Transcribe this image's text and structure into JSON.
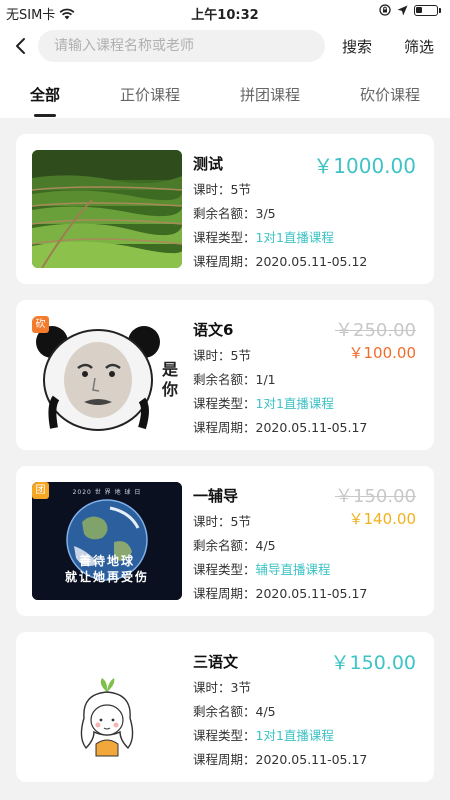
{
  "status_bar": {
    "carrier": "无SIM卡",
    "time": "上午10:32",
    "battery_level": 0.3
  },
  "header": {
    "search_placeholder": "请输入课程名称或老师",
    "search_label": "搜索",
    "filter_label": "筛选"
  },
  "tabs": [
    {
      "label": "全部",
      "active": true
    },
    {
      "label": "正价课程",
      "active": false
    },
    {
      "label": "拼团课程",
      "active": false
    },
    {
      "label": "砍价课程",
      "active": false
    }
  ],
  "labels": {
    "hours": "课时：",
    "remaining": "剩余名额：",
    "type": "课程类型：",
    "period": "课程周期："
  },
  "courses": [
    {
      "title": "测试",
      "price": "￥1000.00",
      "hours": "5节",
      "remaining": "3/5",
      "type": "1对1直播课程",
      "period": "2020.05.11-05.12"
    },
    {
      "title": "语文6",
      "badge": "砍",
      "badge_color": "#f47a2c",
      "original_price": "￥250.00",
      "price": "￥100.00",
      "price_color": "#f36b2a",
      "hours": "5节",
      "remaining": "1/1",
      "type": "1对1直播课程",
      "period": "2020.05.11-05.17",
      "thumb_text": "是你"
    },
    {
      "title": "一辅导",
      "badge": "团",
      "badge_color": "#f5a623",
      "original_price": "￥150.00",
      "price": "￥140.00",
      "price_color": "#f1b11b",
      "hours": "5节",
      "remaining": "4/5",
      "type": "辅导直播课程",
      "period": "2020.05.11-05.17",
      "thumb_top": "2020 世 界 地 球 日",
      "thumb_line1": "善待地球",
      "thumb_line2": "就让她再受伤"
    },
    {
      "title": "三语文",
      "price": "￥150.00",
      "hours": "3节",
      "remaining": "4/5",
      "type": "1对1直播课程",
      "period": "2020.05.11-05.17"
    }
  ],
  "colors": {
    "accent_teal": "#3ec3c6",
    "bargain_orange": "#f36b2a",
    "group_yellow": "#f1b11b",
    "strike_gray": "#c8c8c8"
  }
}
